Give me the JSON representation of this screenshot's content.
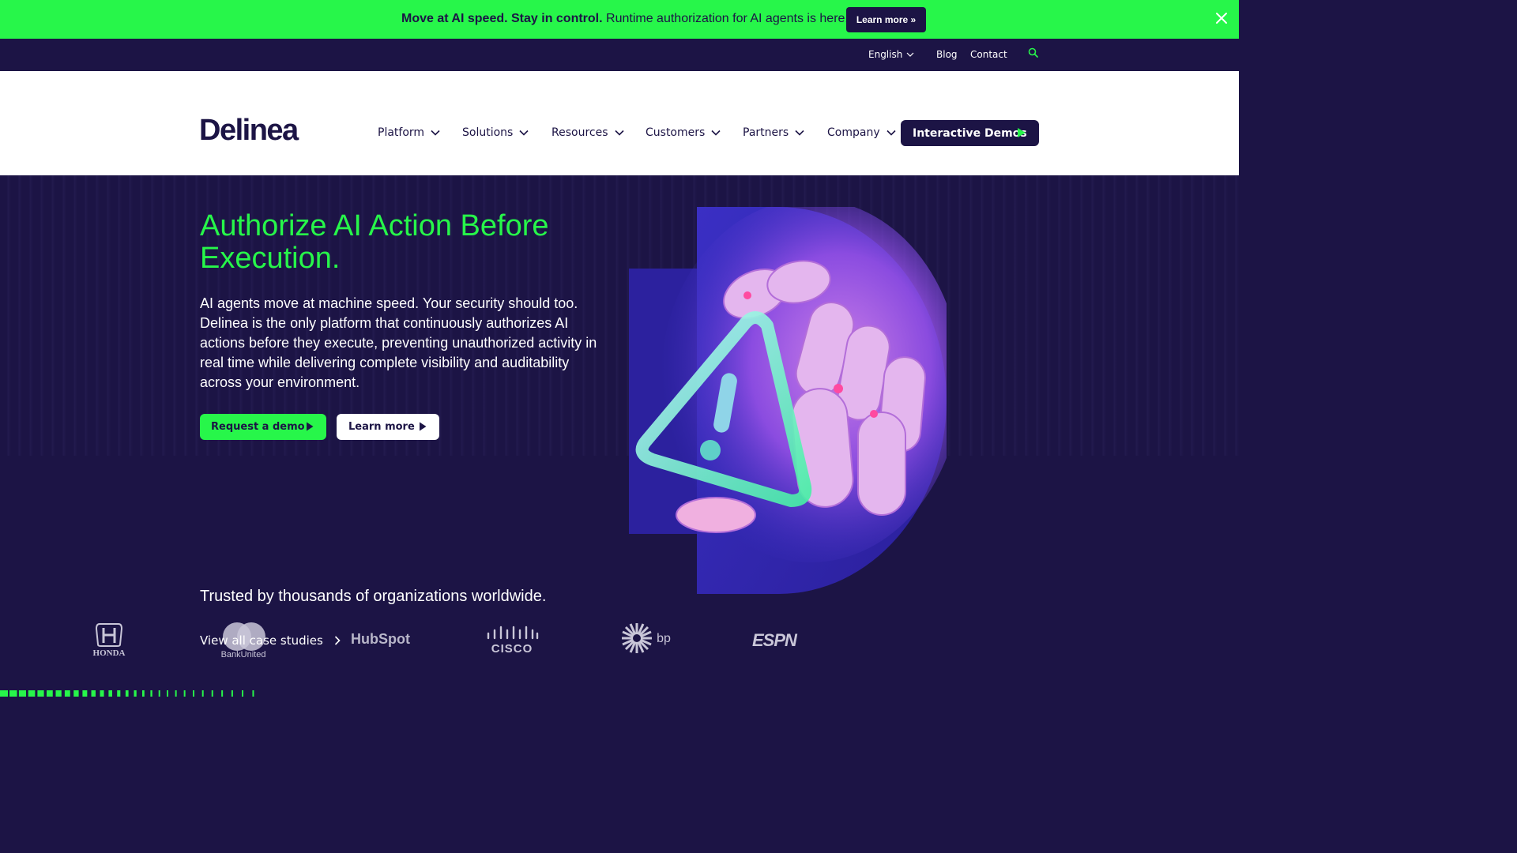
{
  "announcement": {
    "bold_text": "Move at AI speed. Stay in control.",
    "text": "Runtime authorization for AI agents is here.",
    "button_label": "Learn more »",
    "bg_color": "#27f64a"
  },
  "utility_nav": {
    "language": "English",
    "blog": "Blog",
    "contact": "Contact",
    "search_icon": "search-icon"
  },
  "header": {
    "logo": "Delinea",
    "nav": [
      {
        "label": "Platform"
      },
      {
        "label": "Solutions"
      },
      {
        "label": "Resources"
      },
      {
        "label": "Customers"
      },
      {
        "label": "Partners"
      },
      {
        "label": "Company"
      }
    ],
    "cta_label": "Interactive Demos"
  },
  "hero": {
    "title": "Authorize AI Action Before Execution.",
    "body": "AI agents move at machine speed. Your security should too. Delinea is the only platform that continuously authorizes AI actions before they execute, preventing unauthorized activity in real time while delivering complete visibility and auditability across your environment.",
    "primary_button": "Request a demo",
    "secondary_button": "Learn more",
    "accent_color": "#27f64a",
    "bg_color": "#1c1445"
  },
  "trusted": {
    "heading": "Trusted by thousands of organizations worldwide.",
    "case_link": "View all case studies",
    "logos": [
      "HONDA",
      "BankUnited",
      "HubSpot",
      "CISCO",
      "bp",
      "ESPN"
    ]
  }
}
